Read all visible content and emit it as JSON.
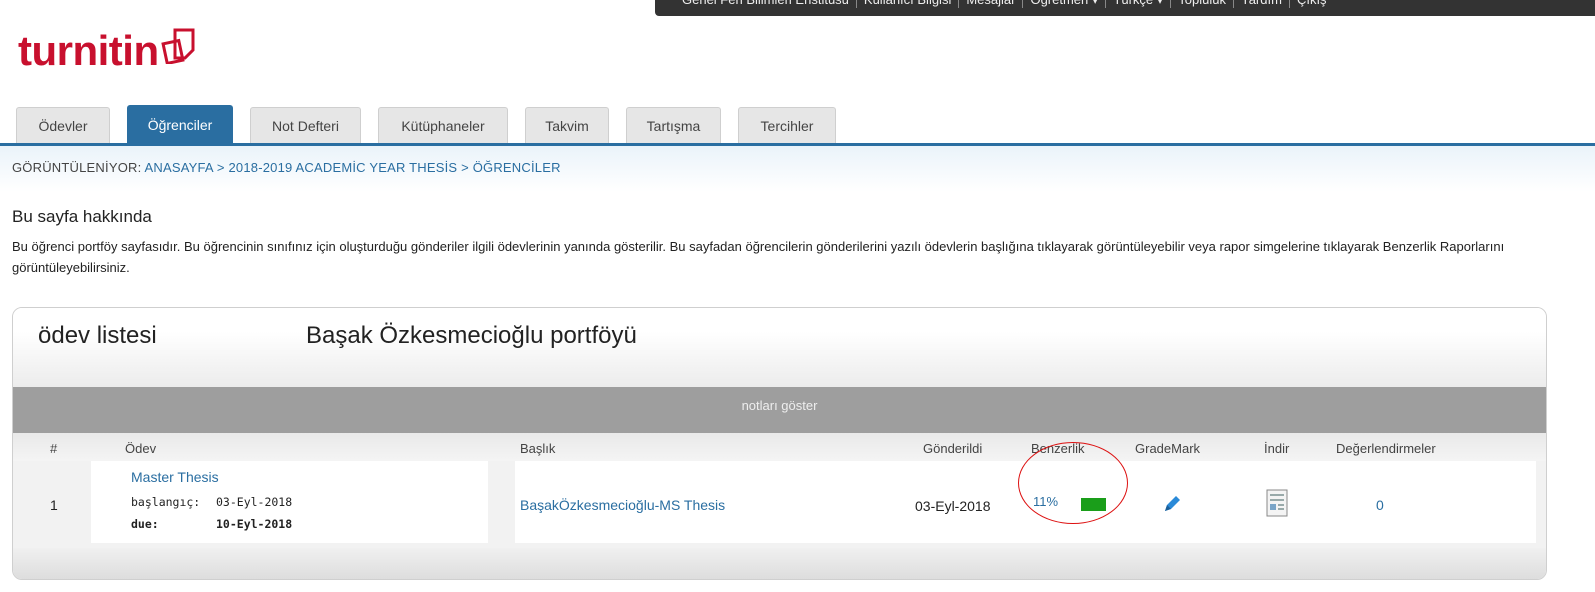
{
  "topbar": {
    "items": [
      "Genel Fen Bilimleri Enstitüsü",
      "Kullanıcı Bilgisi",
      "Mesajlar",
      "Öğretmen ▾",
      "Türkçe ▾",
      "Topluluk",
      "Yardım",
      "Çıkış"
    ]
  },
  "logo": {
    "text": "turnitin"
  },
  "tabs": [
    {
      "label": "Ödevler"
    },
    {
      "label": "Öğrenciler"
    },
    {
      "label": "Not Defteri"
    },
    {
      "label": "Kütüphaneler"
    },
    {
      "label": "Takvim"
    },
    {
      "label": "Tartışma"
    },
    {
      "label": "Tercihler"
    }
  ],
  "breadcrumb": {
    "label": "GÖRÜNTÜLENİYOR:",
    "path": "ANASAYFA > 2018-2019 ACADEMİC YEAR THESİS > ÖĞRENCİLER"
  },
  "about": {
    "title": "Bu sayfa hakkında",
    "text": "Bu öğrenci portföy sayfasıdır. Bu öğrencinin sınıfınız için oluşturduğu gönderiler ilgili ödevlerinin yanında gösterilir. Bu sayfadan öğrencilerin gönderilerini yazılı ödevlerin başlığına tıklayarak görüntüleyebilir veya rapor simgelerine tıklayarak Benzerlik Raporlarını görüntüleyebilirsiniz."
  },
  "card": {
    "list_title": "ödev listesi",
    "portfolio_title": "Başak Özkesmecioğlu portföyü",
    "show_notes": "notları göster"
  },
  "table": {
    "headers": {
      "num": "#",
      "odev": "Ödev",
      "baslik": "Başlık",
      "gonderildi": "Gönderildi",
      "benzerlik": "Benzerlik",
      "grademark": "GradeMark",
      "indir": "İndir",
      "degerlendirmeler": "Değerlendirmeler"
    },
    "rows": [
      {
        "num": "1",
        "odev": "Master Thesis",
        "start_label": "başlangıç:",
        "start_date": "03-Eyl-2018",
        "due_label": "due:",
        "due_date": "10-Eyl-2018",
        "baslik": "BaşakÖzkesmecioğlu-MS Thesis",
        "gonderildi": "03-Eyl-2018",
        "benzerlik": "11%",
        "degerlendirmeler": "0"
      }
    ]
  },
  "colors": {
    "brand_red": "#c8102e",
    "tab_active": "#2a6ea1",
    "link": "#2a6ea1",
    "similarity_bar": "#1a9e1a",
    "annotation_ring": "#dd1111"
  }
}
